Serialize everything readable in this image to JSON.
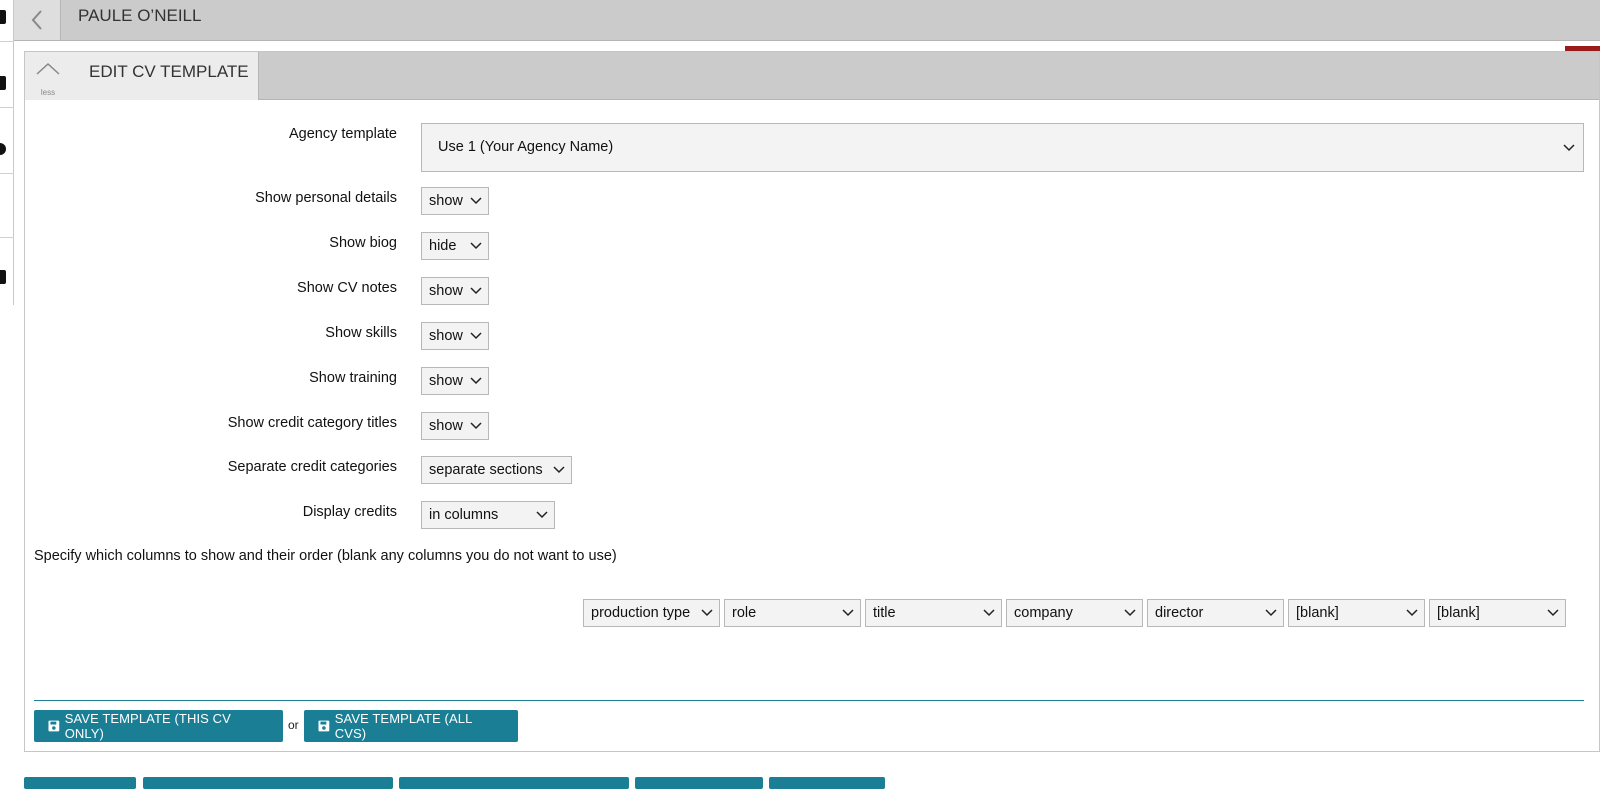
{
  "header": {
    "person_name": "PAULE O’NEILL",
    "back_icon": "chevron-left-icon"
  },
  "panel": {
    "title": "EDIT CV TEMPLATE",
    "collapse_label": "less",
    "alert_icon": "warning-icon"
  },
  "form": {
    "agency_template": {
      "label": "Agency template",
      "value": "Use 1 (Your Agency Name)"
    },
    "personal_details": {
      "label": "Show personal details",
      "value": "show"
    },
    "biog": {
      "label": "Show biog",
      "value": "hide"
    },
    "cv_notes": {
      "label": "Show CV notes",
      "value": "show"
    },
    "skills": {
      "label": "Show skills",
      "value": "show"
    },
    "training": {
      "label": "Show training",
      "value": "show"
    },
    "credit_titles": {
      "label": "Show credit category titles",
      "value": "show"
    },
    "separate_credits": {
      "label": "Separate credit categories",
      "value": "separate sections"
    },
    "display_credits": {
      "label": "Display credits",
      "value": "in columns"
    }
  },
  "columns": {
    "instructions": "Specify which columns to show and their order (blank any columns you do not want to use)",
    "values": [
      "production type",
      "role",
      "title",
      "company",
      "director",
      "[blank]",
      "[blank]"
    ]
  },
  "actions": {
    "save_this": "SAVE TEMPLATE (THIS CV ONLY)",
    "or": "or",
    "save_all": "SAVE TEMPLATE (ALL CVS)",
    "save_icon": "floppy-disk-icon"
  },
  "colors": {
    "accent": "#1a7f95",
    "alert": "#9b1b1b",
    "header_bg": "#cbcbcb"
  }
}
